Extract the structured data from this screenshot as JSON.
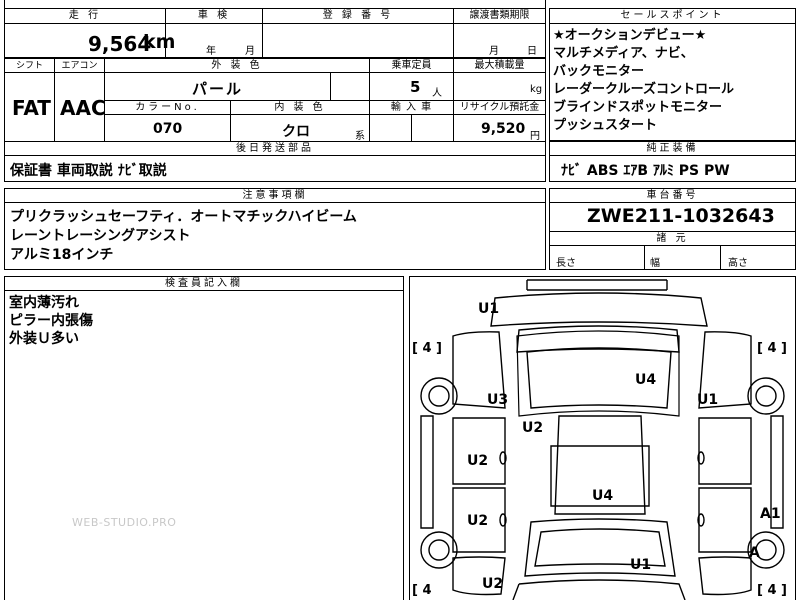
{
  "top": {
    "mileage_header": "走 行",
    "mileage_value": "9,564",
    "mileage_unit": "km",
    "inspection_header": "車 検",
    "inspection_year": "年",
    "inspection_month": "月",
    "registration_header": "登 録 番 号",
    "transfer_header": "譲渡書類期限",
    "transfer_month": "月",
    "transfer_day": "日"
  },
  "sales_points": {
    "header": "セールスポイント",
    "items": [
      "★オークションデビュー★",
      "マルチメディア、ナビ、",
      "バックモニター",
      "レーダークルーズコントロール",
      "ブラインドスポットモニター",
      "プッシュスタート"
    ]
  },
  "specs": {
    "shift_header": "シフト",
    "shift_value": "FAT",
    "aircon_header": "エアコン",
    "aircon_value": "AAC",
    "exterior_header": "外 装 色",
    "exterior_value": "パール",
    "capacity_header": "乗車定員",
    "capacity_value": "5",
    "capacity_unit": "人",
    "load_header": "最大積載量",
    "load_unit": "kg",
    "color_no_header": "カラーNo.",
    "color_no_value": "070",
    "interior_header": "内 装 色",
    "interior_value": "クロ",
    "interior_unit": "系",
    "import_header": "輸 入 車",
    "recycle_header": "リサイクル預託金",
    "recycle_value": "9,520",
    "recycle_unit": "円"
  },
  "later_parts": {
    "header": "後日発送部品",
    "value": "保証書 車両取説 ﾅﾋﾞ取説"
  },
  "genuine_equipment": {
    "header": "純正装備",
    "value": "ﾅﾋﾞ ABS ｴｱB ｱﾙﾐ PS PW"
  },
  "notes": {
    "header": "注意事項欄",
    "lines": [
      "プリクラッシュセーフティ．オートマチックハイビーム",
      "レーントレーシングアシスト",
      "アルミ18インチ"
    ]
  },
  "chassis": {
    "header": "車台番号",
    "value": "ZWE211-1032643"
  },
  "dimensions": {
    "header": "諸 元",
    "length": "長さ",
    "width": "幅",
    "height": "高さ"
  },
  "inspector": {
    "header": "検査員記入欄",
    "lines": [
      "室内薄汚れ",
      "ピラー内張傷",
      "外装Ｕ多い"
    ]
  },
  "watermark": "WEB-STUDIO.PRO",
  "diagram": {
    "marks": [
      "U1",
      "U4",
      "U3",
      "U1",
      "U2",
      "U2",
      "U4",
      "U2",
      "A1",
      "A",
      "U1",
      "U2"
    ],
    "tires": [
      "[ 4 ]",
      "[ 4 ]",
      "[ 4",
      "[ 4 ]"
    ]
  }
}
